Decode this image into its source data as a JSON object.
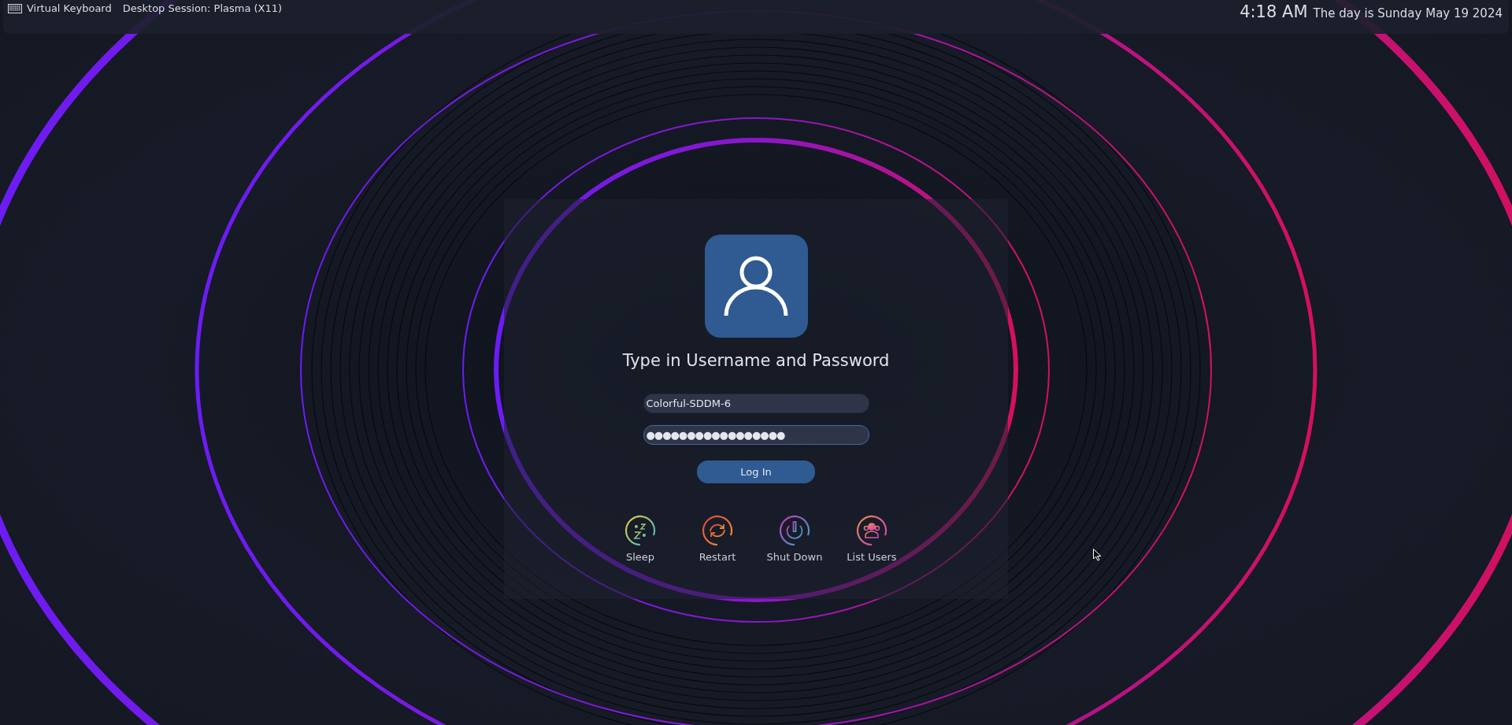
{
  "top_bar": {
    "items": [
      {
        "kind": "keyboard",
        "label": "Virtual Keyboard"
      },
      {
        "kind": "session",
        "label": "Desktop Session: Plasma (X11)"
      }
    ],
    "time": "4:18 AM",
    "date": "The day is Sunday May 19 2024"
  },
  "login": {
    "prompt": "Type in Username and Password",
    "username": {
      "value": "Colorful-SDDM-6",
      "focused": false
    },
    "password": {
      "value": "●●●●●●●●●●●●●●●●●",
      "focused": true
    },
    "button": "Log In"
  },
  "actions": [
    {
      "kind": "sleep",
      "label": "Sleep"
    },
    {
      "kind": "restart",
      "label": "Restart"
    },
    {
      "kind": "shutdown",
      "label": "Shut Down"
    },
    {
      "kind": "users",
      "label": "List Users"
    }
  ]
}
